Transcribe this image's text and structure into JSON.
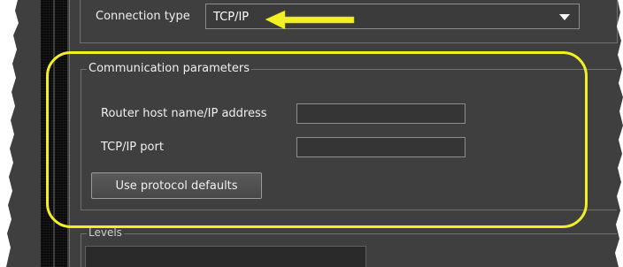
{
  "connection": {
    "label": "Connection type",
    "selected": "TCP/IP"
  },
  "communication": {
    "title": "Communication parameters",
    "host_label": "Router host name/IP address",
    "host_value": "",
    "port_label": "TCP/IP port",
    "port_value": "",
    "defaults_button": "Use protocol defaults"
  },
  "levels": {
    "title": "Levels"
  },
  "colors": {
    "panel_bg": "#3f3f3f",
    "highlight": "#f2ef24"
  }
}
